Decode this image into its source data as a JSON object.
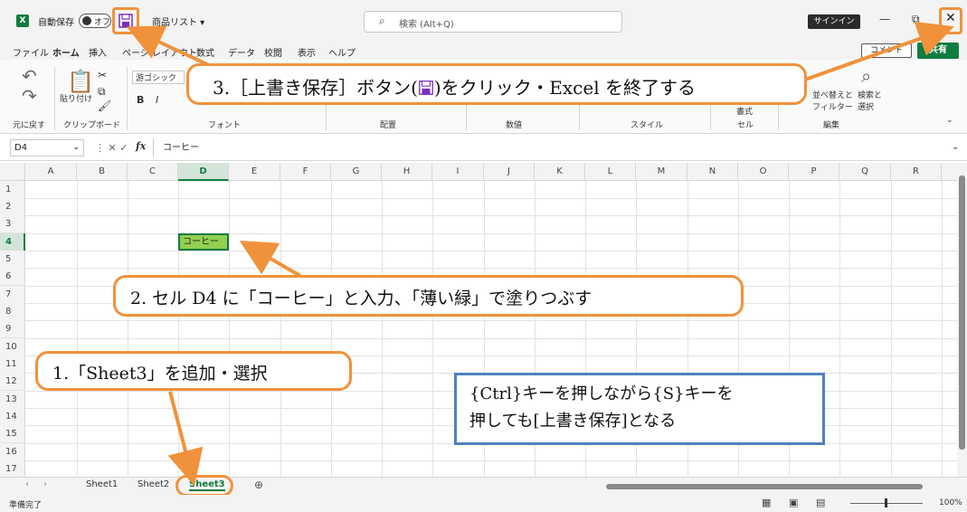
{
  "titlebar": {
    "autosave_label": "自動保存",
    "toggle_label": "オフ",
    "filename": "商品リスト ▾",
    "search_placeholder": "検索 (Alt+Q)",
    "signin_label": "サインイン",
    "minimize": "—",
    "restore": "⧉",
    "close": "✕"
  },
  "menu": {
    "items": [
      "ファイル",
      "ホーム",
      "挿入",
      "ページ レイアウト",
      "数式",
      "データ",
      "校閲",
      "表示",
      "ヘルプ"
    ],
    "comment_label": "コメント",
    "share_label": "共有"
  },
  "ribbon": {
    "undo_label": "元に戻す",
    "paste_label": "貼り付け",
    "clipboard_label": "クリップボード",
    "font_name": "游ゴシック",
    "font_label": "フォント",
    "bold": "B",
    "italic": "I",
    "align_label": "配置",
    "number_label": "数値",
    "style_label": "スタイル",
    "cells_label": "セル",
    "edit_label": "編集",
    "sort_label": "並べ替えと\nフィルター",
    "find_label": "検索と\n選択",
    "format_label": "書式"
  },
  "formula": {
    "namebox": "D4",
    "fx": "fx",
    "value": "コーヒー"
  },
  "grid": {
    "columns": [
      "A",
      "B",
      "C",
      "D",
      "E",
      "F",
      "G",
      "H",
      "I",
      "J",
      "K",
      "L",
      "M",
      "N",
      "O",
      "P",
      "Q",
      "R"
    ],
    "rows": [
      "1",
      "2",
      "3",
      "4",
      "5",
      "6",
      "7",
      "8",
      "9",
      "10",
      "11",
      "12",
      "13",
      "14",
      "15",
      "16",
      "17"
    ],
    "cell_d4": "コーヒー"
  },
  "sheets": {
    "tabs": [
      "Sheet1",
      "Sheet2",
      "Sheet3"
    ],
    "active": "Sheet3",
    "add": "⊕"
  },
  "status": {
    "text": "準備完了",
    "zoom": "100%"
  },
  "callouts": {
    "step1": "1.「Sheet3」を追加・選択",
    "step2": "2. セル D4 に「コーヒー」と入力、「薄い緑」で塗りつぶす",
    "step3_pre": "3.［上書き保存］ボタン(",
    "step3_post": ")をクリック・Excel を終了する",
    "note_line1": "{Ctrl}キーを押しながら{S}キーを",
    "note_line2": "押しても[上書き保存]となる"
  },
  "colors": {
    "accent_green": "#107c41",
    "light_green_fill": "#92d050",
    "callout_orange": "#f0923b",
    "note_blue": "#4f81bd"
  }
}
